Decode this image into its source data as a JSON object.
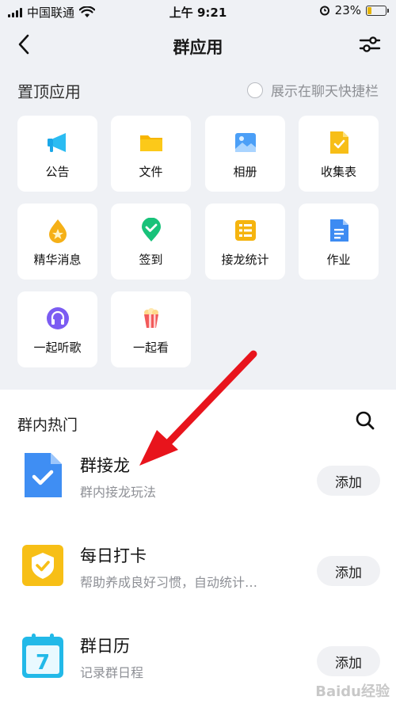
{
  "status_bar": {
    "carrier": "中国联通",
    "time": "上午 9:21",
    "battery": "23%",
    "battery_level": 0.23
  },
  "nav": {
    "title": "群应用"
  },
  "pinned": {
    "title": "置顶应用",
    "show_in_chat_label": "展示在聊天快捷栏",
    "apps": [
      {
        "label": "公告",
        "icon": "megaphone-icon"
      },
      {
        "label": "文件",
        "icon": "folder-icon"
      },
      {
        "label": "相册",
        "icon": "photo-album-icon"
      },
      {
        "label": "收集表",
        "icon": "form-icon"
      },
      {
        "label": "精华消息",
        "icon": "essence-drop-icon"
      },
      {
        "label": "签到",
        "icon": "check-in-pin-icon"
      },
      {
        "label": "接龙统计",
        "icon": "relay-stats-icon"
      },
      {
        "label": "作业",
        "icon": "homework-doc-icon"
      },
      {
        "label": "一起听歌",
        "icon": "headphones-icon"
      },
      {
        "label": "一起看",
        "icon": "popcorn-icon"
      }
    ]
  },
  "hot": {
    "title": "群内热门",
    "items": [
      {
        "name": "群接龙",
        "desc": "群内接龙玩法",
        "button": "添加",
        "icon": "relay-doc-icon"
      },
      {
        "name": "每日打卡",
        "desc": "帮助养成良好习惯，自动统计…",
        "button": "添加",
        "icon": "daily-checkin-icon"
      },
      {
        "name": "群日历",
        "desc": "记录群日程",
        "button": "添加",
        "icon": "calendar-icon",
        "calendar_day": "7"
      }
    ]
  },
  "watermark": "Baidu经验",
  "colors": {
    "background_top": "#eff1f5",
    "annotation_arrow": "#e8141c",
    "accent_blue": "#3d8bf2",
    "accent_yellow": "#f5c21b"
  }
}
